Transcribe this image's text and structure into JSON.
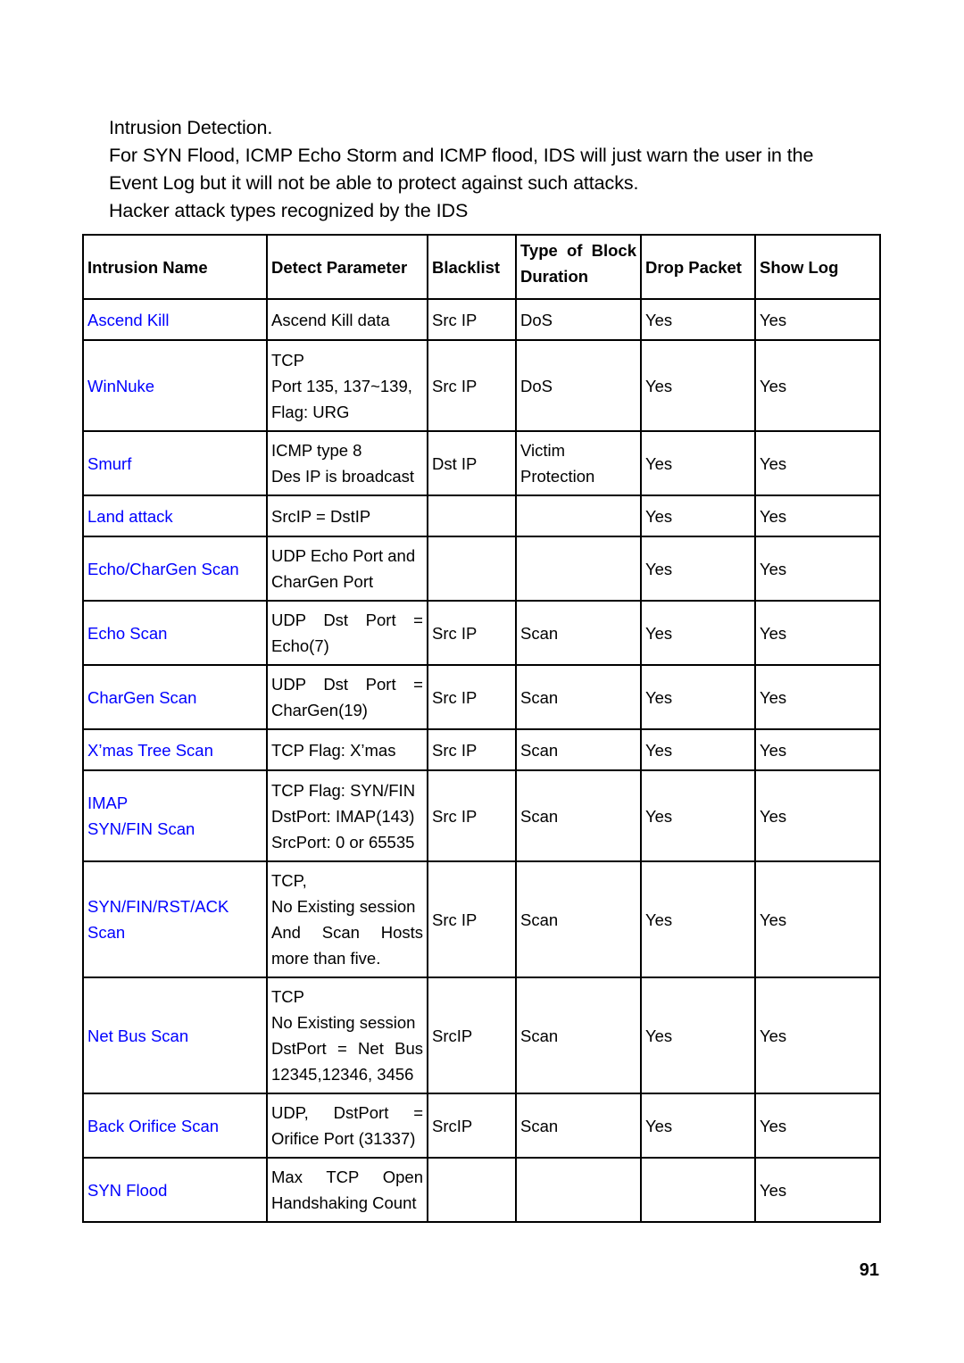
{
  "document": {
    "page_number": "91",
    "intro_lines": [
      "Intrusion Detection.",
      "For SYN Flood, ICMP Echo Storm and ICMP flood, IDS will just warn the user in the",
      "Event Log but it will not be able to protect against such attacks.",
      "Hacker attack types recognized by the IDS"
    ]
  },
  "colors": {
    "intrusion_name": "#0000FF",
    "text": "#000000",
    "border": "#000000",
    "background": "#FFFFFF"
  },
  "table": {
    "headers": {
      "intrusion_name": "Intrusion Name",
      "detect_parameter": "Detect Parameter",
      "blacklist": "Blacklist",
      "block_duration_line1": "Type of Block",
      "block_duration_line2": "Duration",
      "drop_packet": "Drop Packet",
      "show_log": "Show Log"
    },
    "rows": [
      {
        "name": "Ascend Kill",
        "detect": [
          "Ascend Kill data"
        ],
        "blacklist": "Src IP",
        "block_type": "DoS",
        "drop_packet": "Yes",
        "show_log": "Yes"
      },
      {
        "name": "WinNuke",
        "detect": [
          "TCP",
          "Port 135, 137~139,",
          "Flag: URG"
        ],
        "blacklist": "Src IP",
        "block_type": "DoS",
        "drop_packet": "Yes",
        "show_log": "Yes"
      },
      {
        "name": "Smurf",
        "detect": [
          "ICMP type 8",
          "Des IP is broadcast"
        ],
        "blacklist": "Dst IP",
        "block_type_line1": "Victim",
        "block_type_line2": "Protection",
        "drop_packet": "Yes",
        "show_log": "Yes"
      },
      {
        "name": "Land attack",
        "detect": [
          "SrcIP = DstIP"
        ],
        "blacklist": "",
        "block_type": "",
        "drop_packet": "Yes",
        "show_log": "Yes"
      },
      {
        "name": "Echo/CharGen Scan",
        "detect": [
          "UDP Echo Port and",
          "CharGen Port"
        ],
        "blacklist": "",
        "block_type": "",
        "drop_packet": "Yes",
        "show_log": "Yes"
      },
      {
        "name": "Echo Scan",
        "detect": [
          "UDP Dst Port =",
          "Echo(7)"
        ],
        "blacklist": "Src IP",
        "block_type": "Scan",
        "drop_packet": "Yes",
        "show_log": "Yes"
      },
      {
        "name": "CharGen Scan",
        "detect": [
          "UDP Dst Port =",
          "CharGen(19)"
        ],
        "blacklist": "Src IP",
        "block_type": "Scan",
        "drop_packet": "Yes",
        "show_log": "Yes"
      },
      {
        "name": "X’mas Tree Scan",
        "detect": [
          "TCP Flag: X’mas"
        ],
        "blacklist": "Src IP",
        "block_type": "Scan",
        "drop_packet": "Yes",
        "show_log": "Yes"
      },
      {
        "name_line1": "IMAP",
        "name_line2": "SYN/FIN Scan",
        "detect": [
          "TCP Flag: SYN/FIN",
          "DstPort: IMAP(143)",
          "SrcPort: 0 or 65535"
        ],
        "blacklist": "Src IP",
        "block_type": "Scan",
        "drop_packet": "Yes",
        "show_log": "Yes"
      },
      {
        "name_line1": "SYN/FIN/RST/ACK",
        "name_line2": "Scan",
        "detect": [
          "TCP,",
          "No Existing session",
          "And Scan Hosts",
          "more than five."
        ],
        "blacklist": "Src IP",
        "block_type": "Scan",
        "drop_packet": "Yes",
        "show_log": "Yes"
      },
      {
        "name": "Net Bus Scan",
        "detect": [
          "TCP",
          "No Existing session",
          "DstPort = Net Bus",
          "12345,12346, 3456"
        ],
        "blacklist": "SrcIP",
        "block_type": "Scan",
        "drop_packet": "Yes",
        "show_log": "Yes"
      },
      {
        "name": "Back Orifice Scan",
        "detect": [
          "UDP, DstPort =",
          "Orifice Port (31337)"
        ],
        "blacklist": "SrcIP",
        "block_type": "Scan",
        "drop_packet": "Yes",
        "show_log": "Yes"
      },
      {
        "name": "SYN Flood",
        "detect": [
          "Max TCP Open",
          "Handshaking Count"
        ],
        "blacklist": "",
        "block_type": "",
        "drop_packet": "",
        "show_log": "Yes"
      }
    ]
  }
}
